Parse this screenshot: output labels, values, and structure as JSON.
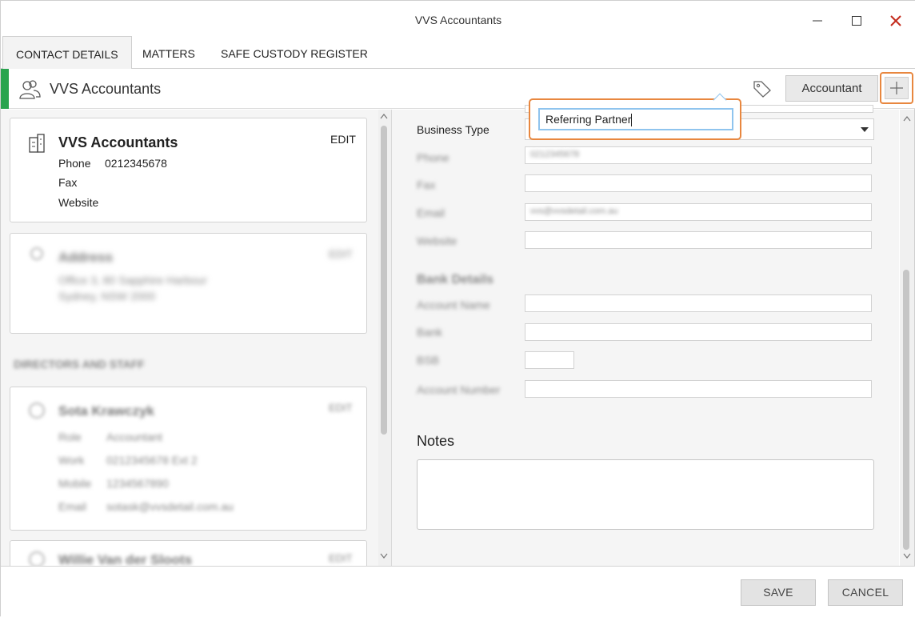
{
  "window": {
    "title": "VVS Accountants"
  },
  "tabs": [
    {
      "label": "CONTACT DETAILS"
    },
    {
      "label": "MATTERS"
    },
    {
      "label": "SAFE CUSTODY REGISTER"
    }
  ],
  "header": {
    "title": "VVS Accountants",
    "tag_button": "Accountant"
  },
  "contact_card": {
    "name": "VVS Accountants",
    "edit": "EDIT",
    "phone_label": "Phone",
    "phone_value": "0212345678",
    "fax_label": "Fax",
    "website_label": "Website"
  },
  "address_card": {
    "title": "Address",
    "edit": "EDIT",
    "line1": "Office 3, 80 Sapphire Harbour",
    "line2": "Sydney, NSW 2000"
  },
  "section_directors": "DIRECTORS AND STAFF",
  "staff_cards": [
    {
      "name": "Sota Krawczyk",
      "edit": "EDIT",
      "role_label": "Role",
      "role_value": "Accountant",
      "work_label": "Work",
      "work_value": "0212345678 Ext 2",
      "mobile_label": "Mobile",
      "mobile_value": "1234567890",
      "email_label": "Email",
      "email_value": "sotask@vvsdetail.com.au"
    },
    {
      "name": "Willie Van der Sloots",
      "edit": "EDIT"
    }
  ],
  "form": {
    "business_type_label": "Business Type",
    "phone_label": "Phone",
    "phone_value": "0212345678",
    "fax_label": "Fax",
    "email_label": "Email",
    "email_value": "vvs@vvsdetail.com.au",
    "website_label": "Website",
    "bank_heading": "Bank Details",
    "account_name_label": "Account Name",
    "bank_label": "Bank",
    "bsb_label": "BSB",
    "account_number_label": "Account Number",
    "notes_label": "Notes"
  },
  "popup": {
    "value": "Referring Partner"
  },
  "footer": {
    "save": "SAVE",
    "cancel": "CANCEL"
  },
  "colors": {
    "accent_green": "#2aa44f",
    "highlight_orange": "#e8873f",
    "focus_blue": "#8fc4ee",
    "close_red": "#c42b1c"
  }
}
